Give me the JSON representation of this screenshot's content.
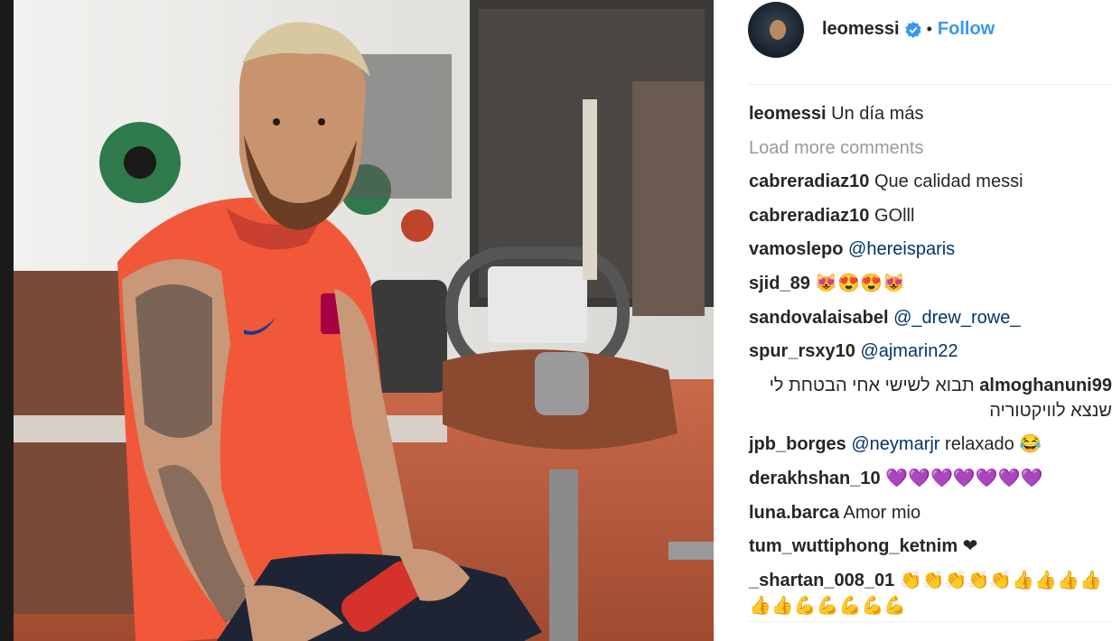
{
  "post": {
    "username": "leomessi",
    "separator": "•",
    "follow_label": "Follow",
    "caption": {
      "user": "leomessi",
      "text": "Un día más"
    },
    "load_more": "Load more comments"
  },
  "comments": [
    {
      "user": "cabreradiaz10",
      "text": "Que calidad messi"
    },
    {
      "user": "cabreradiaz10",
      "text": "GOlll"
    },
    {
      "user": "vamoslepo",
      "mention": "@hereisparis"
    },
    {
      "user": "sjid_89",
      "text": "😻😍😍😻"
    },
    {
      "user": "sandovalaisabel",
      "mention": "@_drew_rowe_"
    },
    {
      "user": "spur_rsxy10",
      "mention": "@ajmarin22"
    },
    {
      "user": "almoghanuni99",
      "text": "תבוא לשישי אחי הבטחת לי שנצא לוויקטוריה"
    },
    {
      "user": "jpb_borges",
      "mention": "@neymarjr",
      "text": "relaxado 😂"
    },
    {
      "user": "derakhshan_10",
      "text": "💜💜💜💜💜💜💜"
    },
    {
      "user": "luna.barca",
      "text": "Amor mio"
    },
    {
      "user": "tum_wuttiphong_ketnim",
      "text": "❤"
    },
    {
      "user": "_shartan_008_01",
      "text": "👏👏👏👏👏👍👍👍👍👍👍💪💪💪💪💪"
    }
  ],
  "colors": {
    "link": "#3897f0",
    "mention": "#003569",
    "muted": "#999999",
    "text": "#262626"
  },
  "icons": {
    "verified": "verified-badge-icon"
  }
}
